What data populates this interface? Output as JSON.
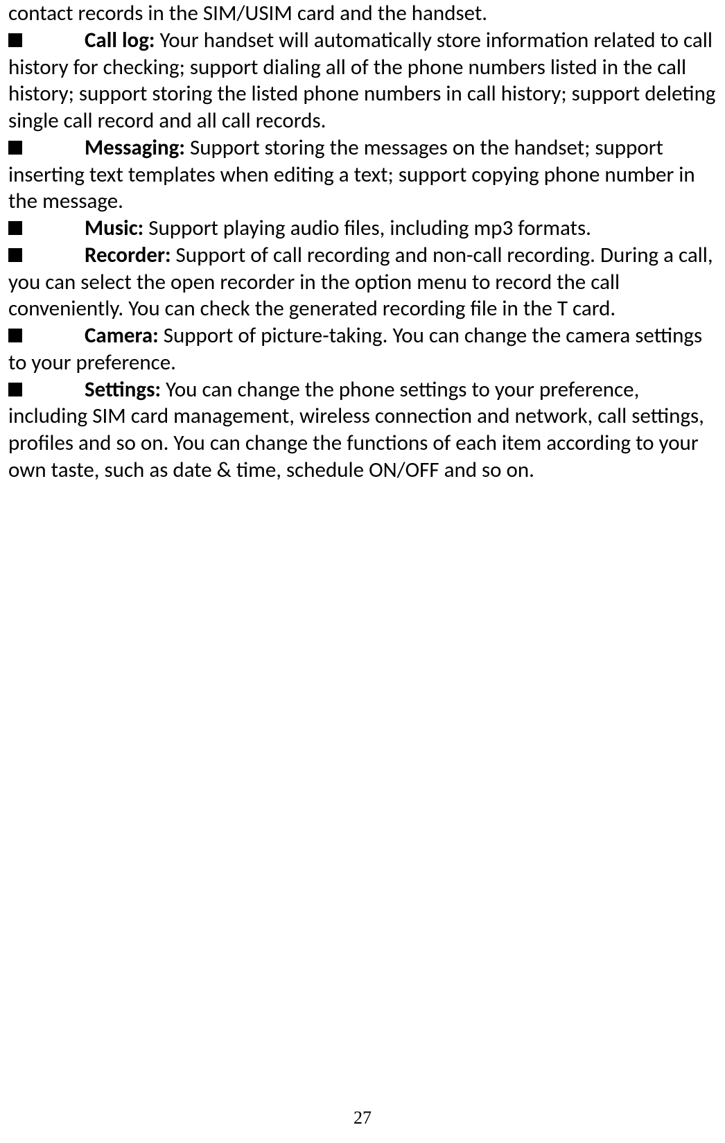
{
  "page": {
    "number": "27"
  },
  "content": {
    "intro_line": "contact records in the SIM/USIM card and the handset.",
    "items": [
      {
        "title": "Call log:",
        "text": " Your handset will automatically store information related to call history for checking; support dialing all of the phone numbers listed in the call history; support storing the listed phone numbers in call history; support deleting single call record and all call records."
      },
      {
        "title": "Messaging:",
        "text": " Support storing the messages on the handset; support inserting text templates when editing a text; support copying phone number in the message."
      },
      {
        "title": "Music:",
        "text": " Support playing audio files, including mp3 formats."
      },
      {
        "title": "Recorder:",
        "text": " Support of call recording and non-call recording. During a call, you can select the open recorder in the option menu to record the call conveniently. You can check the generated recording file in the T card."
      },
      {
        "title": "Camera:",
        "text": " Support of picture-taking. You can change the camera settings to your preference."
      },
      {
        "title": "Settings:",
        "text": " You can change the phone settings to your preference, including SIM card management, wireless connection and network, call settings, profiles and so on. You can change the functions of each item according to your own taste, such as date & time, schedule ON/OFF and so on."
      }
    ]
  }
}
